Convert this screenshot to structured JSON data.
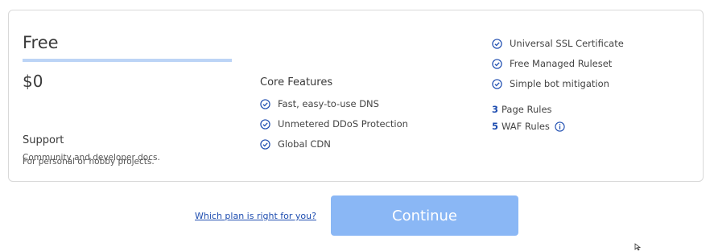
{
  "plan": {
    "name": "Free",
    "price": "$0",
    "support_title": "Support",
    "support_text": "Community and developer docs.",
    "description": "For personal or hobby projects."
  },
  "core": {
    "title": "Core Features",
    "features": [
      "Fast, easy-to-use DNS",
      "Unmetered DDoS Protection",
      "Global CDN"
    ]
  },
  "extras": {
    "features": [
      "Universal SSL Certificate",
      "Free Managed Ruleset",
      "Simple bot mitigation"
    ],
    "page_rules": {
      "count": "3",
      "label": "Page Rules"
    },
    "waf_rules": {
      "count": "5",
      "label": "WAF Rules"
    }
  },
  "footer": {
    "help_link": "Which plan is right for you?",
    "continue_label": "Continue"
  },
  "colors": {
    "accent": "#1e4db0",
    "button": "#8ab7f5",
    "bar": "#bcd4f6"
  }
}
